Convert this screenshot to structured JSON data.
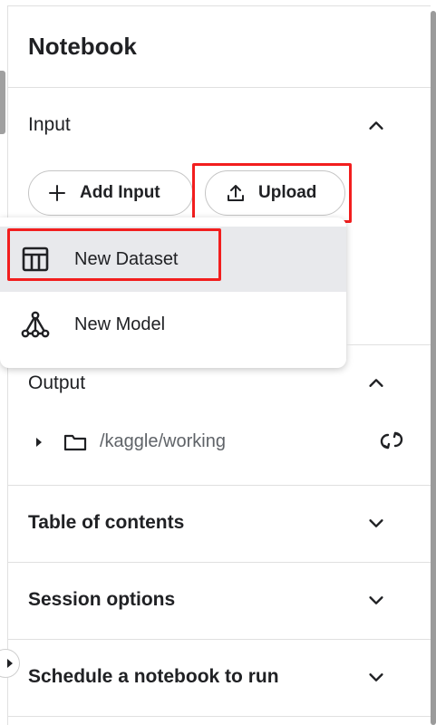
{
  "panel": {
    "title": "Notebook"
  },
  "input_section": {
    "title": "Input",
    "add_input_label": "Add Input",
    "upload_label": "Upload"
  },
  "upload_menu": {
    "items": [
      {
        "label": "New Dataset",
        "icon": "table-icon",
        "active": true
      },
      {
        "label": "New Model",
        "icon": "model-icon",
        "active": false
      }
    ]
  },
  "output_section": {
    "title": "Output",
    "folder_path": "/kaggle/working"
  },
  "sections": [
    {
      "title": "Table of contents"
    },
    {
      "title": "Session options"
    },
    {
      "title": "Schedule a notebook to run"
    }
  ],
  "colors": {
    "highlight": "#f21e1e",
    "menu_active_bg": "#e8e9ec",
    "text": "#202124",
    "muted_text": "#5f6368"
  }
}
